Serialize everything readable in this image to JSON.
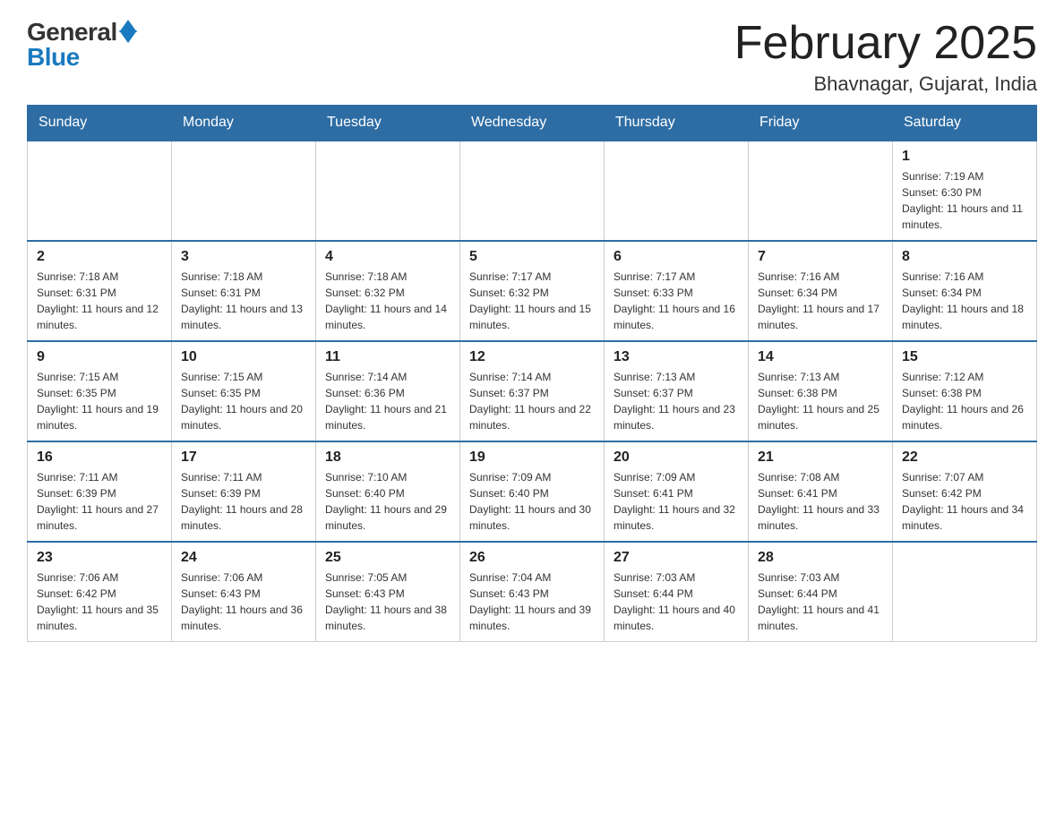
{
  "header": {
    "logo_general": "General",
    "logo_blue": "Blue",
    "month_title": "February 2025",
    "location": "Bhavnagar, Gujarat, India"
  },
  "weekdays": [
    "Sunday",
    "Monday",
    "Tuesday",
    "Wednesday",
    "Thursday",
    "Friday",
    "Saturday"
  ],
  "weeks": [
    [
      {
        "day": "",
        "info": ""
      },
      {
        "day": "",
        "info": ""
      },
      {
        "day": "",
        "info": ""
      },
      {
        "day": "",
        "info": ""
      },
      {
        "day": "",
        "info": ""
      },
      {
        "day": "",
        "info": ""
      },
      {
        "day": "1",
        "info": "Sunrise: 7:19 AM\nSunset: 6:30 PM\nDaylight: 11 hours and 11 minutes."
      }
    ],
    [
      {
        "day": "2",
        "info": "Sunrise: 7:18 AM\nSunset: 6:31 PM\nDaylight: 11 hours and 12 minutes."
      },
      {
        "day": "3",
        "info": "Sunrise: 7:18 AM\nSunset: 6:31 PM\nDaylight: 11 hours and 13 minutes."
      },
      {
        "day": "4",
        "info": "Sunrise: 7:18 AM\nSunset: 6:32 PM\nDaylight: 11 hours and 14 minutes."
      },
      {
        "day": "5",
        "info": "Sunrise: 7:17 AM\nSunset: 6:32 PM\nDaylight: 11 hours and 15 minutes."
      },
      {
        "day": "6",
        "info": "Sunrise: 7:17 AM\nSunset: 6:33 PM\nDaylight: 11 hours and 16 minutes."
      },
      {
        "day": "7",
        "info": "Sunrise: 7:16 AM\nSunset: 6:34 PM\nDaylight: 11 hours and 17 minutes."
      },
      {
        "day": "8",
        "info": "Sunrise: 7:16 AM\nSunset: 6:34 PM\nDaylight: 11 hours and 18 minutes."
      }
    ],
    [
      {
        "day": "9",
        "info": "Sunrise: 7:15 AM\nSunset: 6:35 PM\nDaylight: 11 hours and 19 minutes."
      },
      {
        "day": "10",
        "info": "Sunrise: 7:15 AM\nSunset: 6:35 PM\nDaylight: 11 hours and 20 minutes."
      },
      {
        "day": "11",
        "info": "Sunrise: 7:14 AM\nSunset: 6:36 PM\nDaylight: 11 hours and 21 minutes."
      },
      {
        "day": "12",
        "info": "Sunrise: 7:14 AM\nSunset: 6:37 PM\nDaylight: 11 hours and 22 minutes."
      },
      {
        "day": "13",
        "info": "Sunrise: 7:13 AM\nSunset: 6:37 PM\nDaylight: 11 hours and 23 minutes."
      },
      {
        "day": "14",
        "info": "Sunrise: 7:13 AM\nSunset: 6:38 PM\nDaylight: 11 hours and 25 minutes."
      },
      {
        "day": "15",
        "info": "Sunrise: 7:12 AM\nSunset: 6:38 PM\nDaylight: 11 hours and 26 minutes."
      }
    ],
    [
      {
        "day": "16",
        "info": "Sunrise: 7:11 AM\nSunset: 6:39 PM\nDaylight: 11 hours and 27 minutes."
      },
      {
        "day": "17",
        "info": "Sunrise: 7:11 AM\nSunset: 6:39 PM\nDaylight: 11 hours and 28 minutes."
      },
      {
        "day": "18",
        "info": "Sunrise: 7:10 AM\nSunset: 6:40 PM\nDaylight: 11 hours and 29 minutes."
      },
      {
        "day": "19",
        "info": "Sunrise: 7:09 AM\nSunset: 6:40 PM\nDaylight: 11 hours and 30 minutes."
      },
      {
        "day": "20",
        "info": "Sunrise: 7:09 AM\nSunset: 6:41 PM\nDaylight: 11 hours and 32 minutes."
      },
      {
        "day": "21",
        "info": "Sunrise: 7:08 AM\nSunset: 6:41 PM\nDaylight: 11 hours and 33 minutes."
      },
      {
        "day": "22",
        "info": "Sunrise: 7:07 AM\nSunset: 6:42 PM\nDaylight: 11 hours and 34 minutes."
      }
    ],
    [
      {
        "day": "23",
        "info": "Sunrise: 7:06 AM\nSunset: 6:42 PM\nDaylight: 11 hours and 35 minutes."
      },
      {
        "day": "24",
        "info": "Sunrise: 7:06 AM\nSunset: 6:43 PM\nDaylight: 11 hours and 36 minutes."
      },
      {
        "day": "25",
        "info": "Sunrise: 7:05 AM\nSunset: 6:43 PM\nDaylight: 11 hours and 38 minutes."
      },
      {
        "day": "26",
        "info": "Sunrise: 7:04 AM\nSunset: 6:43 PM\nDaylight: 11 hours and 39 minutes."
      },
      {
        "day": "27",
        "info": "Sunrise: 7:03 AM\nSunset: 6:44 PM\nDaylight: 11 hours and 40 minutes."
      },
      {
        "day": "28",
        "info": "Sunrise: 7:03 AM\nSunset: 6:44 PM\nDaylight: 11 hours and 41 minutes."
      },
      {
        "day": "",
        "info": ""
      }
    ]
  ]
}
